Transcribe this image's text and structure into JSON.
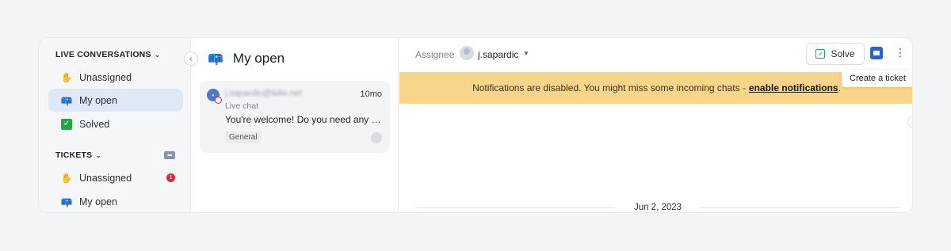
{
  "sidebar": {
    "live_section": {
      "title": "LIVE CONVERSATIONS"
    },
    "live_items": [
      {
        "label": "Unassigned",
        "icon": "hand-wave-icon"
      },
      {
        "label": "My open",
        "icon": "mailbox-icon"
      },
      {
        "label": "Solved",
        "icon": "check-box-icon"
      }
    ],
    "tickets_section": {
      "title": "TICKETS"
    },
    "ticket_items": [
      {
        "label": "Unassigned",
        "icon": "hand-wave-icon",
        "badge": "1"
      },
      {
        "label": "My open",
        "icon": "mailbox-icon"
      }
    ]
  },
  "list": {
    "title": "My open",
    "chat": {
      "email": "j.sapardic@tidio.net",
      "time": "10mo",
      "channel": "Live chat",
      "preview": "You're welcome! Do you need any more help?",
      "tag": "General"
    }
  },
  "main": {
    "assignee_label": "Assignee",
    "assignee_name": "j.sapardic",
    "solve_label": "Solve",
    "tooltip": "Create a ticket",
    "notification_text": "Notifications are disabled. You might miss some incoming chats -",
    "notification_link": "enable notifications",
    "notification_end": ".",
    "date_separator": "Jun 2, 2023"
  },
  "colors": {
    "notification_bg": "#f8d58a",
    "active_nav_bg": "#dfe8f7",
    "badge_red": "#e0283a",
    "accent_blue": "#2a62d8"
  }
}
